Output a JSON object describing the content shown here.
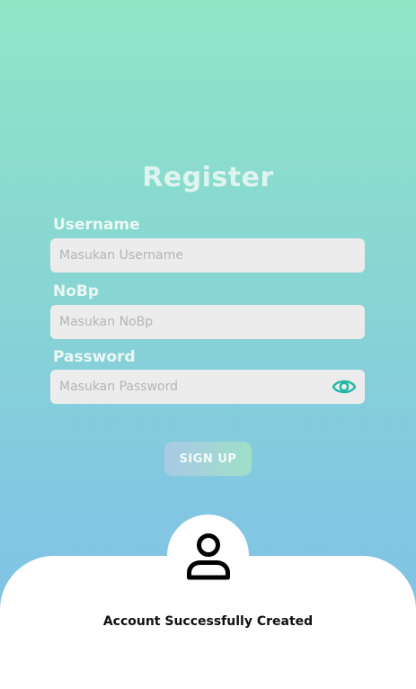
{
  "register": {
    "title": "Register",
    "username": {
      "label": "Username",
      "placeholder": "Masukan Username",
      "value": ""
    },
    "nobp": {
      "label": "NoBp",
      "placeholder": "Masukan NoBp",
      "value": ""
    },
    "password": {
      "label": "Password",
      "placeholder": "Masukan Password",
      "value": ""
    },
    "signup_label": "SIGN UP"
  },
  "success_sheet": {
    "message": "Account Successfully Created"
  },
  "icons": {
    "password_toggle": "eye-icon",
    "account": "user-icon"
  },
  "colors": {
    "gradient_top": "#8fe6c6",
    "gradient_bottom": "#7fc2e6",
    "input_bg": "#ececec",
    "toggle_icon": "#1fb8a6"
  }
}
